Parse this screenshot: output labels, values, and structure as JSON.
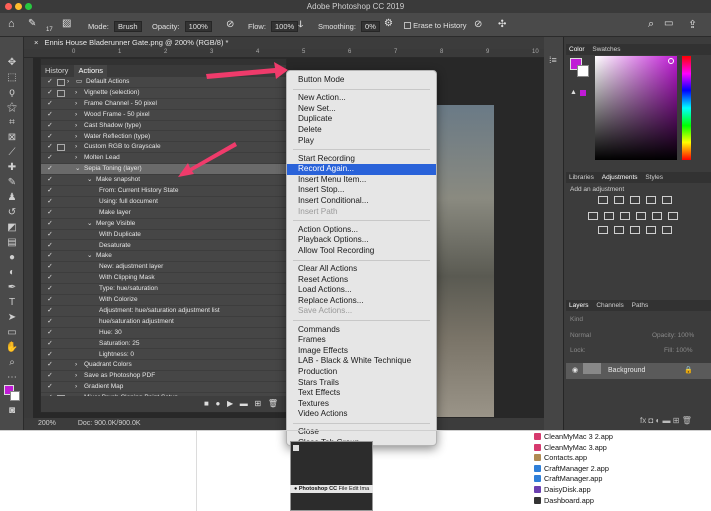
{
  "app": {
    "title": "Adobe Photoshop CC 2019"
  },
  "options_bar": {
    "mode_label": "Mode:",
    "mode_value": "Brush",
    "opacity_label": "Opacity:",
    "opacity_value": "100%",
    "flow_label": "Flow:",
    "flow_value": "100%",
    "smoothing_label": "Smoothing:",
    "smoothing_value": "0%",
    "erase_to_history": "Erase to History",
    "brush_size": "17"
  },
  "document": {
    "tab_title": "Ennis House Bladerunner Gate.png @ 200% (RGB/8) *",
    "zoom": "200%",
    "doc_size": "Doc: 900.0K/900.0K",
    "ruler_ticks": [
      "0",
      "1",
      "2",
      "3",
      "4",
      "5",
      "6",
      "7",
      "8",
      "9",
      "10"
    ]
  },
  "actions_panel": {
    "tabs": [
      "History",
      "Actions"
    ],
    "rows": [
      {
        "label": "Default Actions",
        "level": 0,
        "folder": true,
        "dialog": true
      },
      {
        "label": "Vignette (selection)",
        "level": 1,
        "dialog": true
      },
      {
        "label": "Frame Channel - 50 pixel",
        "level": 1
      },
      {
        "label": "Wood Frame - 50 pixel",
        "level": 1
      },
      {
        "label": "Cast Shadow (type)",
        "level": 1
      },
      {
        "label": "Water Reflection (type)",
        "level": 1
      },
      {
        "label": "Custom RGB to Grayscale",
        "level": 1,
        "dialog": true
      },
      {
        "label": "Molten Lead",
        "level": 1
      },
      {
        "label": "Sepia Toning (layer)",
        "level": 1,
        "selected": true,
        "open": true
      },
      {
        "label": "Make snapshot",
        "level": 2,
        "open": true
      },
      {
        "label": "From: Current History State",
        "level": 3
      },
      {
        "label": "Using: full document",
        "level": 3
      },
      {
        "label": "Make layer",
        "level": 3
      },
      {
        "label": "Merge Visible",
        "level": 2,
        "open": true
      },
      {
        "label": "With Duplicate",
        "level": 3
      },
      {
        "label": "Desaturate",
        "level": 3
      },
      {
        "label": "Make",
        "level": 2,
        "open": true
      },
      {
        "label": "New: adjustment layer",
        "level": 3
      },
      {
        "label": "With Clipping Mask",
        "level": 3
      },
      {
        "label": "Type: hue/saturation",
        "level": 3
      },
      {
        "label": "With Colorize",
        "level": 3
      },
      {
        "label": "Adjustment: hue/saturation adjustment list",
        "level": 3
      },
      {
        "label": "hue/saturation adjustment",
        "level": 3
      },
      {
        "label": "Hue: 30",
        "level": 3
      },
      {
        "label": "Saturation: 25",
        "level": 3
      },
      {
        "label": "Lightness: 0",
        "level": 3
      },
      {
        "label": "Quadrant Colors",
        "level": 1
      },
      {
        "label": "Save as Photoshop PDF",
        "level": 1
      },
      {
        "label": "Gradient Map",
        "level": 1
      },
      {
        "label": "Mixer Brush Cloning Paint Setup",
        "level": 1,
        "dialog": true
      }
    ]
  },
  "context_menu": {
    "groups": [
      [
        "Button Mode"
      ],
      [
        "New Action...",
        "New Set...",
        "Duplicate",
        "Delete",
        "Play"
      ],
      [
        "Start Recording",
        "Record Again...",
        "Insert Menu Item...",
        "Insert Stop...",
        "Insert Conditional...",
        "Insert Path"
      ],
      [
        "Action Options...",
        "Playback Options...",
        "Allow Tool Recording"
      ],
      [
        "Clear All Actions",
        "Reset Actions",
        "Load Actions...",
        "Replace Actions...",
        "Save Actions..."
      ],
      [
        "Commands",
        "Frames",
        "Image Effects",
        "LAB - Black & White Technique",
        "Production",
        "Stars Trails",
        "Text Effects",
        "Textures",
        "Video Actions"
      ],
      [
        "Close",
        "Close Tab Group"
      ]
    ],
    "disabled": [
      "Insert Path",
      "Save Actions..."
    ],
    "highlighted": "Record Again..."
  },
  "color_panel": {
    "tabs": [
      "Color",
      "Swatches"
    ],
    "foreground": "#c01bd6"
  },
  "adjustments_panel": {
    "tabs": [
      "Libraries",
      "Adjustments",
      "Styles"
    ],
    "hint": "Add an adjustment"
  },
  "layers_panel": {
    "tabs": [
      "Layers",
      "Channels",
      "Paths"
    ],
    "kind_label": "Kind",
    "blend_mode": "Normal",
    "opacity_label": "Opacity:",
    "opacity_value": "100%",
    "lock_label": "Lock:",
    "fill_label": "Fill:",
    "fill_value": "100%",
    "layer_name": "Background"
  },
  "finder": {
    "items": [
      {
        "name": "CleanMyMac 3 2.app",
        "color": "#d63a6e"
      },
      {
        "name": "CleanMyMac 3.app",
        "color": "#d63a6e"
      },
      {
        "name": "Contacts.app",
        "color": "#b08a52"
      },
      {
        "name": "CraftManager 2.app",
        "color": "#2f7fd8"
      },
      {
        "name": "CraftManager.app",
        "color": "#2f7fd8"
      },
      {
        "name": "DaisyDisk.app",
        "color": "#6b3fb0"
      },
      {
        "name": "Dashboard.app",
        "color": "#333333"
      }
    ],
    "thumb_menubar": [
      "Photoshop CC",
      "File",
      "Edit",
      "Ima"
    ]
  },
  "colors": {
    "arrow": "#ef3b6b",
    "menu_highlight": "#2962d9"
  }
}
